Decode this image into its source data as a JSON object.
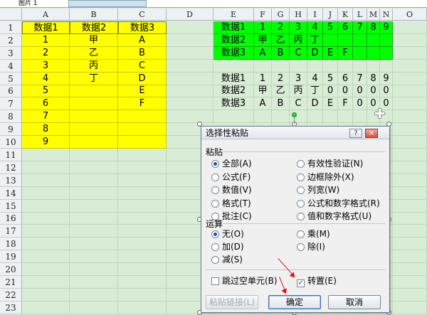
{
  "namebar": {
    "name_box": "图片 1"
  },
  "columns": [
    "A",
    "B",
    "C",
    "D",
    "E",
    "F",
    "G",
    "H",
    "I",
    "J",
    "K",
    "L",
    "M",
    "N",
    "O"
  ],
  "rows": [
    "1",
    "2",
    "3",
    "4",
    "5",
    "6",
    "7",
    "8",
    "9",
    "10",
    "11",
    "12",
    "13",
    "14",
    "15",
    "16",
    "17",
    "18",
    "19",
    "20",
    "21",
    "22",
    "23"
  ],
  "source_table": {
    "headers": [
      "数据1",
      "数据2",
      "数据3"
    ],
    "col_a": [
      "1",
      "2",
      "3",
      "4",
      "5",
      "6",
      "7",
      "8",
      "9"
    ],
    "col_b": [
      "甲",
      "乙",
      "丙",
      "丁"
    ],
    "col_c": [
      "A",
      "B",
      "C",
      "D",
      "E",
      "F"
    ]
  },
  "transposed_green": {
    "row1": [
      "数据1",
      "1",
      "2",
      "3",
      "4",
      "5",
      "6",
      "7",
      "8",
      "9"
    ],
    "row2": [
      "数据2",
      "甲",
      "乙",
      "丙",
      "丁",
      "",
      "",
      "",
      "",
      ""
    ],
    "row3": [
      "数据3",
      "A",
      "B",
      "C",
      "D",
      "E",
      "F",
      "",
      "",
      ""
    ]
  },
  "transposed_plain": {
    "row5": [
      "数据1",
      "1",
      "2",
      "3",
      "4",
      "5",
      "6",
      "7",
      "8",
      "9"
    ],
    "row6": [
      "数据2",
      "甲",
      "乙",
      "丙",
      "丁",
      "0",
      "0",
      "0",
      "0",
      "0"
    ],
    "row7": [
      "数据3",
      "A",
      "B",
      "C",
      "D",
      "E",
      "F",
      "0",
      "0",
      "0"
    ]
  },
  "dialog": {
    "title": "选择性粘贴",
    "help_button": "?",
    "close_button": "×",
    "paste_group_label": "粘贴",
    "paste_options_left": [
      "全部(A)",
      "公式(F)",
      "数值(V)",
      "格式(T)",
      "批注(C)"
    ],
    "paste_options_right": [
      "有效性验证(N)",
      "边框除外(X)",
      "列宽(W)",
      "公式和数字格式(R)",
      "值和数字格式(U)"
    ],
    "paste_selected": "全部(A)",
    "operation_group_label": "运算",
    "operation_options_left": [
      "无(O)",
      "加(D)",
      "减(S)"
    ],
    "operation_options_right": [
      "乘(M)",
      "除(I)"
    ],
    "operation_selected": "无(O)",
    "skip_blanks_label": "跳过空单元(B)",
    "skip_blanks_checked": false,
    "transpose_label": "转置(E)",
    "transpose_checked": true,
    "paste_link_button": "粘贴链接(L)",
    "ok_button": "确定",
    "cancel_button": "取消"
  },
  "colors": {
    "sheet_bg": "#d8ecd6",
    "yellow": "#ffff00",
    "green": "#00ff00",
    "arrow": "#dd1111"
  }
}
